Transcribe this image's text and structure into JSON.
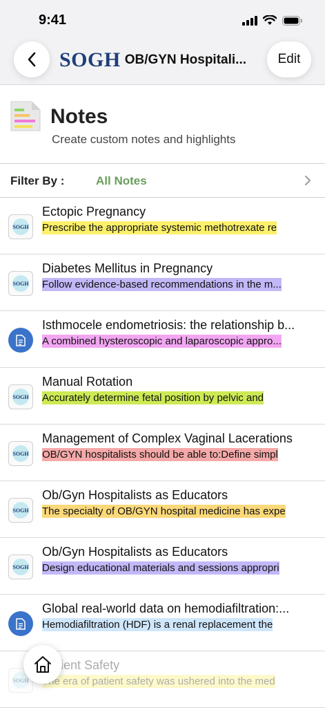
{
  "status": {
    "time": "9:41"
  },
  "nav": {
    "logo": "SOGH",
    "title": "OB/GYN Hospitali...",
    "edit_label": "Edit"
  },
  "header": {
    "title": "Notes",
    "subtitle": "Create custom notes and highlights"
  },
  "filter": {
    "label": "Filter By :",
    "value": "All Notes"
  },
  "colors": {
    "yellow": "#fbf06a",
    "purple": "#c2b8f7",
    "pink": "#f2a6f2",
    "green": "#cdea55",
    "red": "#f4a9a8",
    "orange": "#fbd97a",
    "blue": "#cfe6fb",
    "filter_green": "#6a9e5c",
    "logo_blue": "#1f3f78"
  },
  "notes": [
    {
      "icon": "sogh",
      "title": "Ectopic Pregnancy",
      "snippet": "Prescribe the appropriate systemic methotrexate re",
      "highlight": "#fbf06a"
    },
    {
      "icon": "sogh",
      "title": "Diabetes Mellitus in Pregnancy",
      "snippet": "Follow evidence-based recommendations in the m...",
      "highlight": "#c2b8f7"
    },
    {
      "icon": "doc",
      "title": "Isthmocele endometriosis: the relationship b...",
      "snippet": "A combined hysteroscopic and laparoscopic appro...",
      "highlight": "#f2a6f2"
    },
    {
      "icon": "sogh",
      "title": "Manual Rotation",
      "snippet": "Accurately determine fetal position by pelvic and",
      "highlight": "#cdea55"
    },
    {
      "icon": "sogh",
      "title": "Management of Complex Vaginal Lacerations",
      "snippet": "OB/GYN hospitalists should be able to:Define simpl",
      "highlight": "#f4a9a8"
    },
    {
      "icon": "sogh",
      "title": "Ob/Gyn Hospitalists as Educators",
      "snippet": "The specialty of OB/GYN hospital medicine has expe",
      "highlight": "#fbd97a"
    },
    {
      "icon": "sogh",
      "title": "Ob/Gyn Hospitalists as Educators",
      "snippet": "Design educational materials and sessions appropri",
      "highlight": "#c2b8f7"
    },
    {
      "icon": "doc",
      "title": "Global real-world data on hemodiafiltration:...",
      "snippet": "Hemodiafiltration (HDF) is a renal replacement the",
      "highlight": "#cfe6fb"
    },
    {
      "icon": "sogh",
      "title": "Patient Safety",
      "snippet": "The era of patient safety was ushered into the med",
      "highlight": "#fbf06a"
    }
  ]
}
